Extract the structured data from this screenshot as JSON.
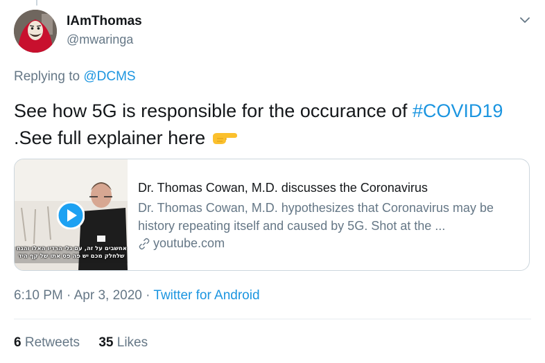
{
  "author": {
    "display_name": "IAmThomas",
    "handle": "@mwaringa",
    "avatar_icon": "avatar-red-hood-mask"
  },
  "reply": {
    "prefix": "Replying to",
    "mention": "@DCMS"
  },
  "tweet": {
    "text_before": "See how 5G is responsible for the occurance of ",
    "hashtag": "#COVID19",
    "text_after": " .See full explainer here",
    "emoji": "backhand-index-pointing-right"
  },
  "card": {
    "title": "Dr. Thomas Cowan, M.D. discusses the Coronavirus",
    "description": "Dr. Thomas Cowan, M.D. hypothesizes that Coronavirus may be history repeating itself and caused by 5G. Shot at the ...",
    "domain": "youtube.com",
    "subtitle_line1": "אחשבים על זה, עם גלי הרדיו האלו והנחיים",
    "subtitle_line2": "שלחלק מכם יש פה פס אתו של קף היד"
  },
  "meta": {
    "time": "6:10 PM",
    "separator": "·",
    "date": "Apr 3, 2020",
    "source": "Twitter for Android"
  },
  "stats": {
    "retweets_count": "6",
    "retweets_label": "Retweets",
    "likes_count": "35",
    "likes_label": "Likes"
  },
  "colors": {
    "link": "#1b95e0",
    "muted": "#657786",
    "text": "#14171a",
    "border": "#ccd6dd"
  }
}
